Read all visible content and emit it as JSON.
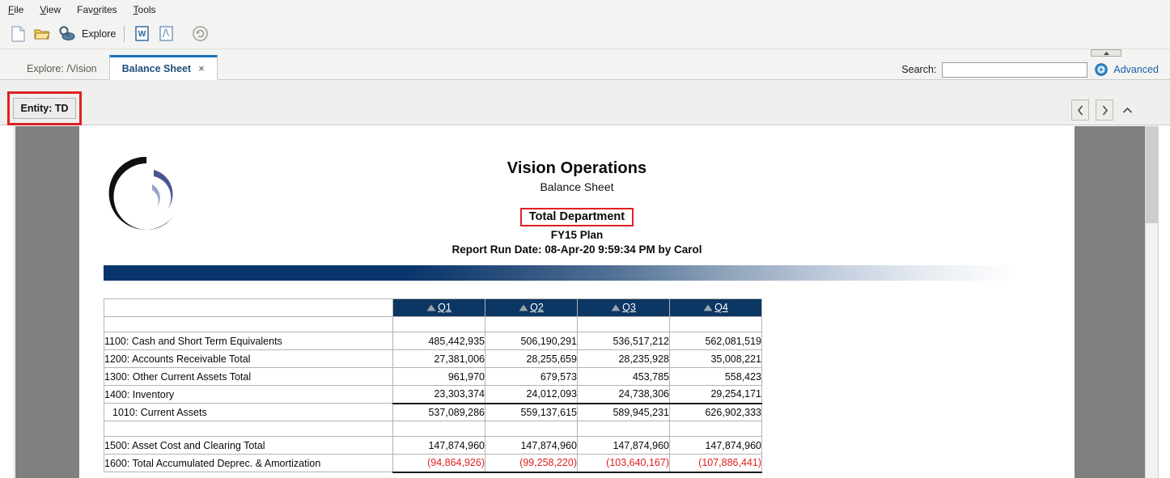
{
  "menu": {
    "items": [
      {
        "name": "file",
        "pre": "F",
        "acc": "",
        "post": "ile",
        "label": "File"
      },
      {
        "name": "view",
        "pre": "V",
        "acc": "",
        "post": "iew",
        "label": "View"
      },
      {
        "name": "favorites",
        "label": "Favorites"
      },
      {
        "name": "tools",
        "label": "Tools"
      }
    ]
  },
  "toolbar": {
    "new_icon": "new-document-icon",
    "open_icon": "open-folder-icon",
    "explore_icon": "explore-icon",
    "explore_label": "Explore",
    "word_icon": "export-to-word-icon",
    "pdf_icon": "export-to-pdf-icon",
    "refresh_icon": "refresh-icon"
  },
  "tabs": [
    {
      "label": "Explore: /Vision",
      "active": false
    },
    {
      "label": "Balance Sheet",
      "active": true,
      "close": "×"
    }
  ],
  "search": {
    "label": "Search:",
    "value": "",
    "placeholder": "",
    "advanced_label": "Advanced",
    "advanced_icon": "advanced-search-icon",
    "collapse_icon": "collapse-up-icon"
  },
  "pov": {
    "entity_label": "Entity: TD",
    "prev_icon": "previous-member-icon",
    "prev_glyph": "‹",
    "next_icon": "next-member-icon",
    "next_glyph": "›",
    "collapse_glyph": "˄",
    "highlight_color": "#e02020"
  },
  "report": {
    "logo_name": "vision-operations-logo",
    "title": "Vision Operations",
    "subtitle": "Balance Sheet",
    "department": "Total Department",
    "plan": "FY15 Plan",
    "run_date": "Report Run Date: 08-Apr-20 9:59:34 PM by Carol"
  },
  "chart_data": {
    "type": "table",
    "title": "Vision Operations Balance Sheet — Total Department, FY15 Plan",
    "columns": [
      "",
      "Q1",
      "Q2",
      "Q3",
      "Q4"
    ],
    "column_icon": "dimension-expand-icon",
    "rows": [
      {
        "kind": "spacer"
      },
      {
        "kind": "data",
        "label": "1100: Cash and Short Term Equivalents",
        "indent": "detail",
        "values": [
          "485,442,935",
          "506,190,291",
          "536,517,212",
          "562,081,519"
        ],
        "negative": false,
        "rule": false
      },
      {
        "kind": "data",
        "label": "1200: Accounts Receivable Total",
        "indent": "detail",
        "values": [
          "27,381,006",
          "28,255,659",
          "28,235,928",
          "35,008,221"
        ],
        "negative": false,
        "rule": false
      },
      {
        "kind": "data",
        "label": "1300: Other Current Assets Total",
        "indent": "detail",
        "values": [
          "961,970",
          "679,573",
          "453,785",
          "558,423"
        ],
        "negative": false,
        "rule": false
      },
      {
        "kind": "data",
        "label": "1400: Inventory",
        "indent": "detail",
        "values": [
          "23,303,374",
          "24,012,093",
          "24,738,306",
          "29,254,171"
        ],
        "negative": false,
        "rule": true
      },
      {
        "kind": "data",
        "label": "1010: Current Assets",
        "indent": "total",
        "values": [
          "537,089,286",
          "559,137,615",
          "589,945,231",
          "626,902,333"
        ],
        "negative": false,
        "rule": false
      },
      {
        "kind": "spacer"
      },
      {
        "kind": "data",
        "label": "1500: Asset Cost and Clearing Total",
        "indent": "detail",
        "values": [
          "147,874,960",
          "147,874,960",
          "147,874,960",
          "147,874,960"
        ],
        "negative": false,
        "rule": false
      },
      {
        "kind": "data",
        "label": "1600: Total Accumulated Deprec. & Amortization",
        "indent": "detail",
        "values": [
          "(94,864,926)",
          "(99,258,220)",
          "(103,640,167)",
          "(107,886,441)"
        ],
        "negative": true,
        "rule": true
      }
    ],
    "header_bg": "#0c3663",
    "negative_color": "#e02020",
    "band_color": "#07356b"
  }
}
